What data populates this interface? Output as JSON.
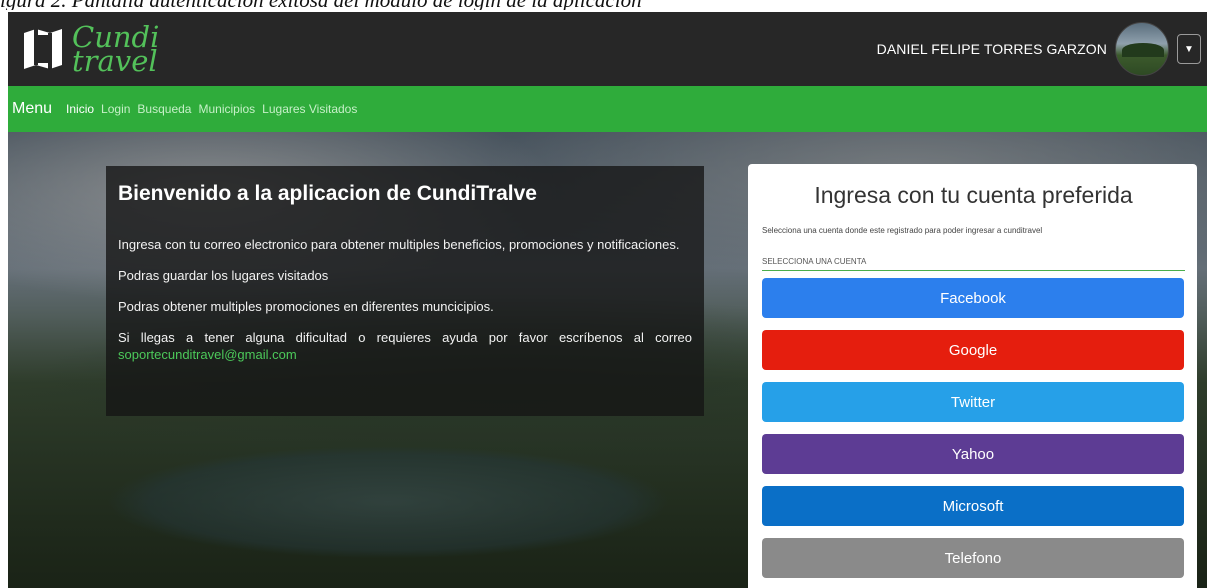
{
  "caption": "igura 2. Pantalla autenticación exitosa del módulo de login de la aplicación",
  "header": {
    "logo_line1": "Cundi",
    "logo_line2": "travel",
    "user_name": "DANIEL FELIPE TORRES GARZON",
    "user_menu_icon": "caret-down-icon"
  },
  "nav": {
    "brand": "Menu",
    "links": [
      "Inicio",
      "Login",
      "Busqueda",
      "Municipios",
      "Lugares Visitados"
    ]
  },
  "welcome": {
    "title": "Bienvenido a la aplicacion de CundiTralve",
    "p1": "Ingresa con tu correo electronico para obtener multiples beneficios, promociones y notificaciones.",
    "p2": "Podras guardar los lugares visitados",
    "p3": "Podras obtener multiples promociones en diferentes muncicipios.",
    "p4": "Si llegas a tener alguna dificultad o requieres ayuda por favor escríbenos al correo",
    "email": "soportecunditravel@gmail.com"
  },
  "login": {
    "title": "Ingresa con tu cuenta preferida",
    "subtitle": "Selecciona una cuenta donde este registrado para poder ingresar a cunditravel",
    "select_placeholder": "SELECCIONA UNA CUENTA",
    "providers": [
      {
        "label": "Facebook",
        "color": "#2c7fed"
      },
      {
        "label": "Google",
        "color": "#e51e0e"
      },
      {
        "label": "Twitter",
        "color": "#26a0e8"
      },
      {
        "label": "Yahoo",
        "color": "#5d3c94"
      },
      {
        "label": "Microsoft",
        "color": "#0a6fc7"
      },
      {
        "label": "Telefono",
        "color": "#8a8a8a"
      }
    ]
  },
  "colors": {
    "topbar": "#272727",
    "navbar": "#2fac3b",
    "accent": "#4cc95a"
  }
}
